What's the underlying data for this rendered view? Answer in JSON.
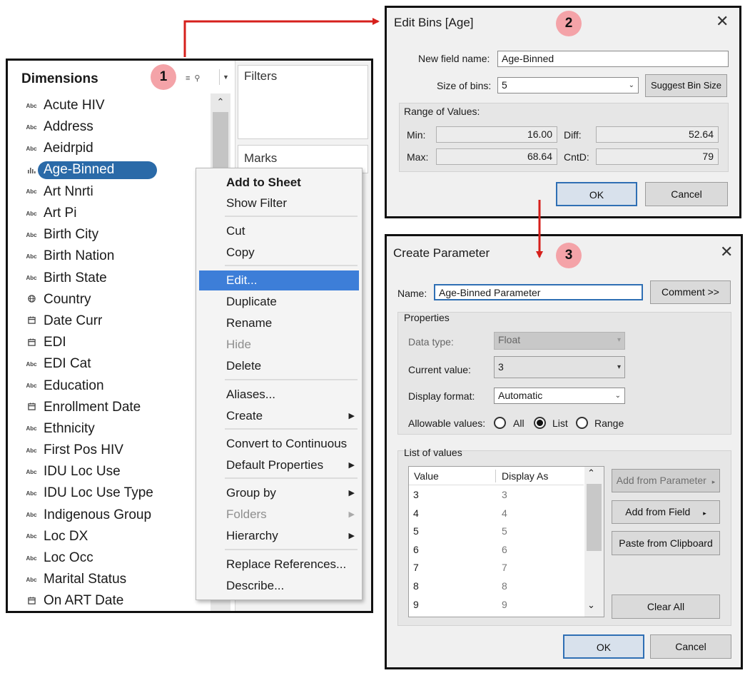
{
  "colors": {
    "arrow": "#d6201c",
    "badge": "#f4a3a8",
    "selection": "#2a6aa8",
    "menu_highlight": "#3d7ed8"
  },
  "badges": [
    "1",
    "2",
    "3"
  ],
  "panel1": {
    "title": "Dimensions",
    "filters_label": "Filters",
    "marks_label": "Marks",
    "items": [
      {
        "label": "Acute HIV",
        "type": "Abc"
      },
      {
        "label": "Address",
        "type": "Abc"
      },
      {
        "label": "Aeidrpid",
        "type": "Abc"
      },
      {
        "label": "Age-Binned",
        "type": "bins-icon",
        "selected": true
      },
      {
        "label": "Art Nnrti",
        "type": "Abc"
      },
      {
        "label": "Art Pi",
        "type": "Abc"
      },
      {
        "label": "Birth City",
        "type": "Abc"
      },
      {
        "label": "Birth Nation",
        "type": "Abc"
      },
      {
        "label": "Birth State",
        "type": "Abc"
      },
      {
        "label": "Country",
        "type": "globe-icon"
      },
      {
        "label": "Date Curr",
        "type": "calendar-icon"
      },
      {
        "label": "EDI",
        "type": "calendar-icon"
      },
      {
        "label": "EDI Cat",
        "type": "Abc"
      },
      {
        "label": "Education",
        "type": "Abc"
      },
      {
        "label": "Enrollment Date",
        "type": "calendar-icon"
      },
      {
        "label": "Ethnicity",
        "type": "Abc"
      },
      {
        "label": "First Pos HIV",
        "type": "Abc"
      },
      {
        "label": "IDU Loc Use",
        "type": "Abc"
      },
      {
        "label": "IDU Loc Use Type",
        "type": "Abc"
      },
      {
        "label": "Indigenous Group",
        "type": "Abc"
      },
      {
        "label": "Loc DX",
        "type": "Abc"
      },
      {
        "label": "Loc Occ",
        "type": "Abc"
      },
      {
        "label": "Marital Status",
        "type": "Abc"
      },
      {
        "label": "On ART Date",
        "type": "calendar-icon"
      }
    ],
    "type_label": "Abc"
  },
  "context_menu": {
    "items": [
      {
        "label": "Add to Sheet",
        "bold": true
      },
      {
        "label": "Show Filter"
      },
      {
        "label": "Cut"
      },
      {
        "label": "Copy"
      },
      {
        "label": "Edit...",
        "highlighted": true
      },
      {
        "label": "Duplicate"
      },
      {
        "label": "Rename"
      },
      {
        "label": "Hide",
        "disabled": true
      },
      {
        "label": "Delete"
      },
      {
        "label": "Aliases..."
      },
      {
        "label": "Create",
        "submenu": true
      },
      {
        "label": "Convert to Continuous"
      },
      {
        "label": "Default Properties",
        "submenu": true
      },
      {
        "label": "Group by",
        "submenu": true
      },
      {
        "label": "Folders",
        "submenu": true,
        "disabled": true
      },
      {
        "label": "Hierarchy",
        "submenu": true
      },
      {
        "label": "Replace References..."
      },
      {
        "label": "Describe..."
      }
    ]
  },
  "edit_bins": {
    "title": "Edit Bins [Age]",
    "new_field_label": "New field name:",
    "new_field_value": "Age-Binned",
    "size_label": "Size of bins:",
    "size_value": "5",
    "suggest_button": "Suggest Bin Size",
    "range_label": "Range of Values:",
    "min_label": "Min:",
    "min_value": "16.00",
    "diff_label": "Diff:",
    "diff_value": "52.64",
    "max_label": "Max:",
    "max_value": "68.64",
    "cntd_label": "CntD:",
    "cntd_value": "79",
    "ok": "OK",
    "cancel": "Cancel"
  },
  "create_param": {
    "title": "Create Parameter",
    "name_label": "Name:",
    "name_value": "Age-Binned Parameter",
    "comment_button": "Comment >>",
    "properties_label": "Properties",
    "data_type_label": "Data type:",
    "data_type_value": "Float",
    "current_value_label": "Current value:",
    "current_value": "3",
    "display_format_label": "Display format:",
    "display_format_value": "Automatic",
    "allowable_label": "Allowable values:",
    "allowable_options": [
      "All",
      "List",
      "Range"
    ],
    "allowable_selected": "List",
    "list_label": "List of values",
    "col_value": "Value",
    "col_display": "Display As",
    "rows": [
      {
        "value": "3",
        "display": "3"
      },
      {
        "value": "4",
        "display": "4"
      },
      {
        "value": "5",
        "display": "5"
      },
      {
        "value": "6",
        "display": "6"
      },
      {
        "value": "7",
        "display": "7"
      },
      {
        "value": "8",
        "display": "8"
      },
      {
        "value": "9",
        "display": "9"
      }
    ],
    "add_from_parameter": "Add from Parameter",
    "add_from_field": "Add from Field",
    "paste_clipboard": "Paste from Clipboard",
    "clear_all": "Clear All",
    "ok": "OK",
    "cancel": "Cancel"
  }
}
